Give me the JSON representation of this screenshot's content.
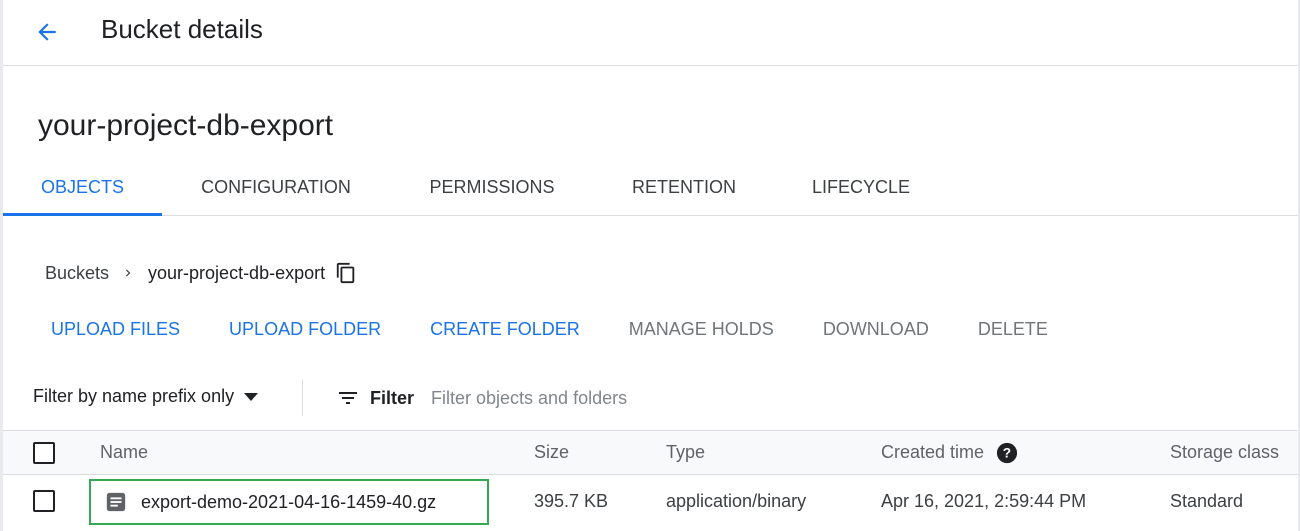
{
  "header": {
    "title": "Bucket details",
    "back_icon": "arrow-back-icon"
  },
  "bucket": {
    "name": "your-project-db-export"
  },
  "tabs": [
    {
      "label": "OBJECTS",
      "active": true
    },
    {
      "label": "CONFIGURATION",
      "active": false
    },
    {
      "label": "PERMISSIONS",
      "active": false
    },
    {
      "label": "RETENTION",
      "active": false
    },
    {
      "label": "LIFECYCLE",
      "active": false
    }
  ],
  "breadcrumb": {
    "root": "Buckets",
    "current": "your-project-db-export",
    "separator_icon": "chevron-right-icon",
    "copy_icon": "copy-icon"
  },
  "actions": {
    "upload_files": "UPLOAD FILES",
    "upload_folder": "UPLOAD FOLDER",
    "create_folder": "CREATE FOLDER",
    "manage_holds": "MANAGE HOLDS",
    "download": "DOWNLOAD",
    "delete": "DELETE"
  },
  "filter": {
    "mode": "Filter by name prefix only",
    "button_label": "Filter",
    "placeholder": "Filter objects and folders"
  },
  "table": {
    "columns": {
      "name": "Name",
      "size": "Size",
      "type": "Type",
      "created": "Created time",
      "storage": "Storage class"
    },
    "rows": [
      {
        "name": "export-demo-2021-04-16-1459-40.gz",
        "size": "395.7 KB",
        "type": "application/binary",
        "created": "Apr 16, 2021, 2:59:44 PM",
        "storage": "Standard"
      }
    ]
  },
  "colors": {
    "accent": "#1a73e8",
    "highlight_box": "#34a853",
    "disabled_text": "#70757a"
  }
}
